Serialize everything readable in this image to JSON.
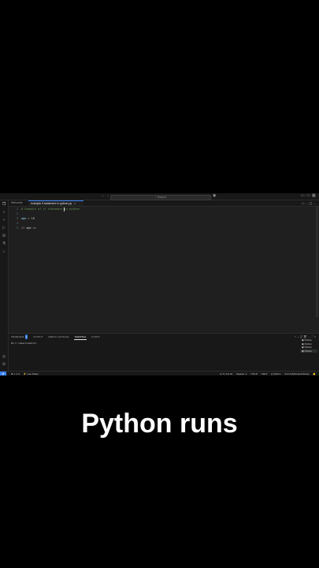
{
  "titlebar": {
    "search_placeholder": "Search"
  },
  "tabs": [
    {
      "label": "Welcome",
      "active": false
    },
    {
      "label": "example if statement in python.py",
      "active": true
    }
  ],
  "editor": {
    "lines": [
      {
        "number": "1",
        "comment": "# Example of if statement in python"
      },
      {
        "number": "2",
        "text": ""
      },
      {
        "number": "3",
        "var": "age",
        "op": " = ",
        "num": "18"
      },
      {
        "number": "4",
        "text": ""
      },
      {
        "number": "5",
        "kw": "if",
        "rest": " age >="
      }
    ]
  },
  "panel": {
    "tabs": [
      {
        "label": "PROBLEMS",
        "badge": "1",
        "active": false
      },
      {
        "label": "OUTPUT",
        "active": false
      },
      {
        "label": "DEBUG CONSOLE",
        "active": false
      },
      {
        "label": "TERMINAL",
        "active": true
      },
      {
        "label": "PORTS",
        "active": false
      }
    ],
    "terminal_output": "PS C:\\Users\\Ankit>",
    "terminals": [
      {
        "label": "Python",
        "active": false
      },
      {
        "label": "Python",
        "active": false
      },
      {
        "label": "Python",
        "active": false
      },
      {
        "label": "Python",
        "active": true
      }
    ]
  },
  "statusbar": {
    "left": [
      "⊗ 1 ⚠ 0",
      "⚡ Live Share"
    ],
    "right": [
      "Ln 5, Col 10",
      "Spaces: 4",
      "UTF-8",
      "CRLF",
      "{} Python",
      "3.11.9 (Microsoft Store)"
    ]
  },
  "caption": "Python runs",
  "colors": {
    "accent": "#3b82f6",
    "editor_bg": "#1f1f1f",
    "chrome_bg": "#181818"
  }
}
